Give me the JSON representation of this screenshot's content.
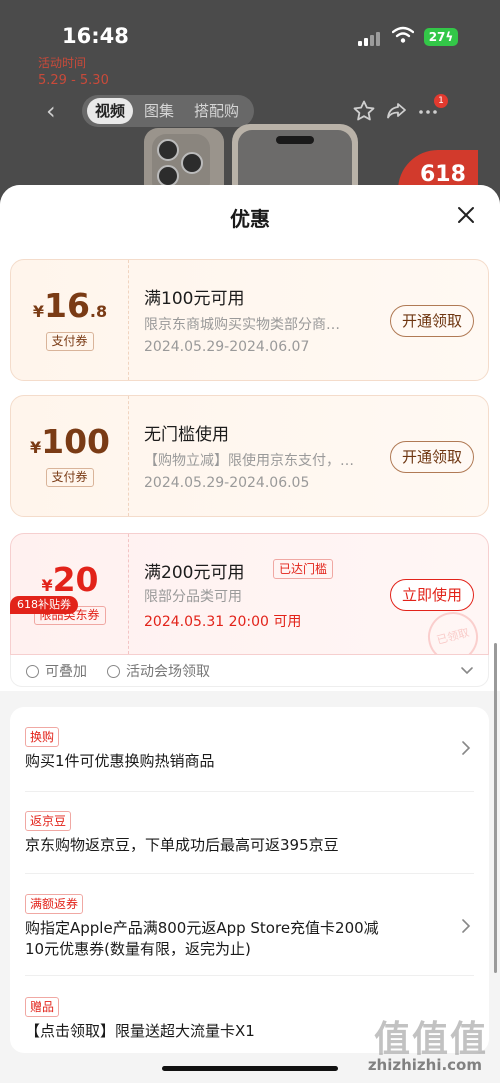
{
  "status_bar": {
    "time": "16:48",
    "battery": "27"
  },
  "background_page": {
    "promo_label": "活动时间",
    "promo_dates": "5.29 - 5.30",
    "tabs": [
      "视频",
      "图集",
      "搭配购"
    ],
    "active_tab": "视频",
    "more_badge": "1",
    "promo_tag": "618"
  },
  "sheet": {
    "title": "优惠",
    "coupons": [
      {
        "currency": "¥",
        "amount": "16",
        "decimal": ".8",
        "type": "支付券",
        "title": "满100元可用",
        "desc": "限京东商城购买实物类部分商…",
        "date": "2024.05.29-2024.06.07",
        "button": "开通领取"
      },
      {
        "currency": "¥",
        "amount": "100",
        "decimal": "",
        "type": "支付券",
        "title": "无门槛使用",
        "desc": "【购物立减】限使用京东支付，…",
        "date": "2024.05.29-2024.06.05",
        "button": "开通领取"
      },
      {
        "ribbon": "618补贴券",
        "currency": "¥",
        "amount": "20",
        "decimal": "",
        "type": "限品类东券",
        "title": "满200元可用",
        "reached_tag": "已达门槛",
        "desc": "限部分品类可用",
        "date": "2024.05.31 20:00 可用",
        "button": "立即使用",
        "stamp": "已领取"
      }
    ],
    "coupon_features": [
      "可叠加",
      "活动会场领取"
    ],
    "benefits": [
      {
        "tag": "换购",
        "text": "购买1件可优惠换购热销商品",
        "has_arrow": true
      },
      {
        "tag": "返京豆",
        "text": "京东购物返京豆，下单成功后最高可返395京豆",
        "has_arrow": false
      },
      {
        "tag": "满额返券",
        "text": "购指定Apple产品满800元返App Store充值卡200减10元优惠券(数量有限，返完为止)",
        "has_arrow": true
      },
      {
        "tag": "赠品",
        "text": "【点击领取】限量送超大流量卡X1",
        "has_arrow": false
      }
    ]
  },
  "watermark": {
    "glyphs": "值值值",
    "text": "zhizhizhi.com"
  },
  "colors": {
    "accent_red": "#e2231a",
    "coupon_brown": "#7a3b15",
    "overlay": "#4b4b4b"
  }
}
